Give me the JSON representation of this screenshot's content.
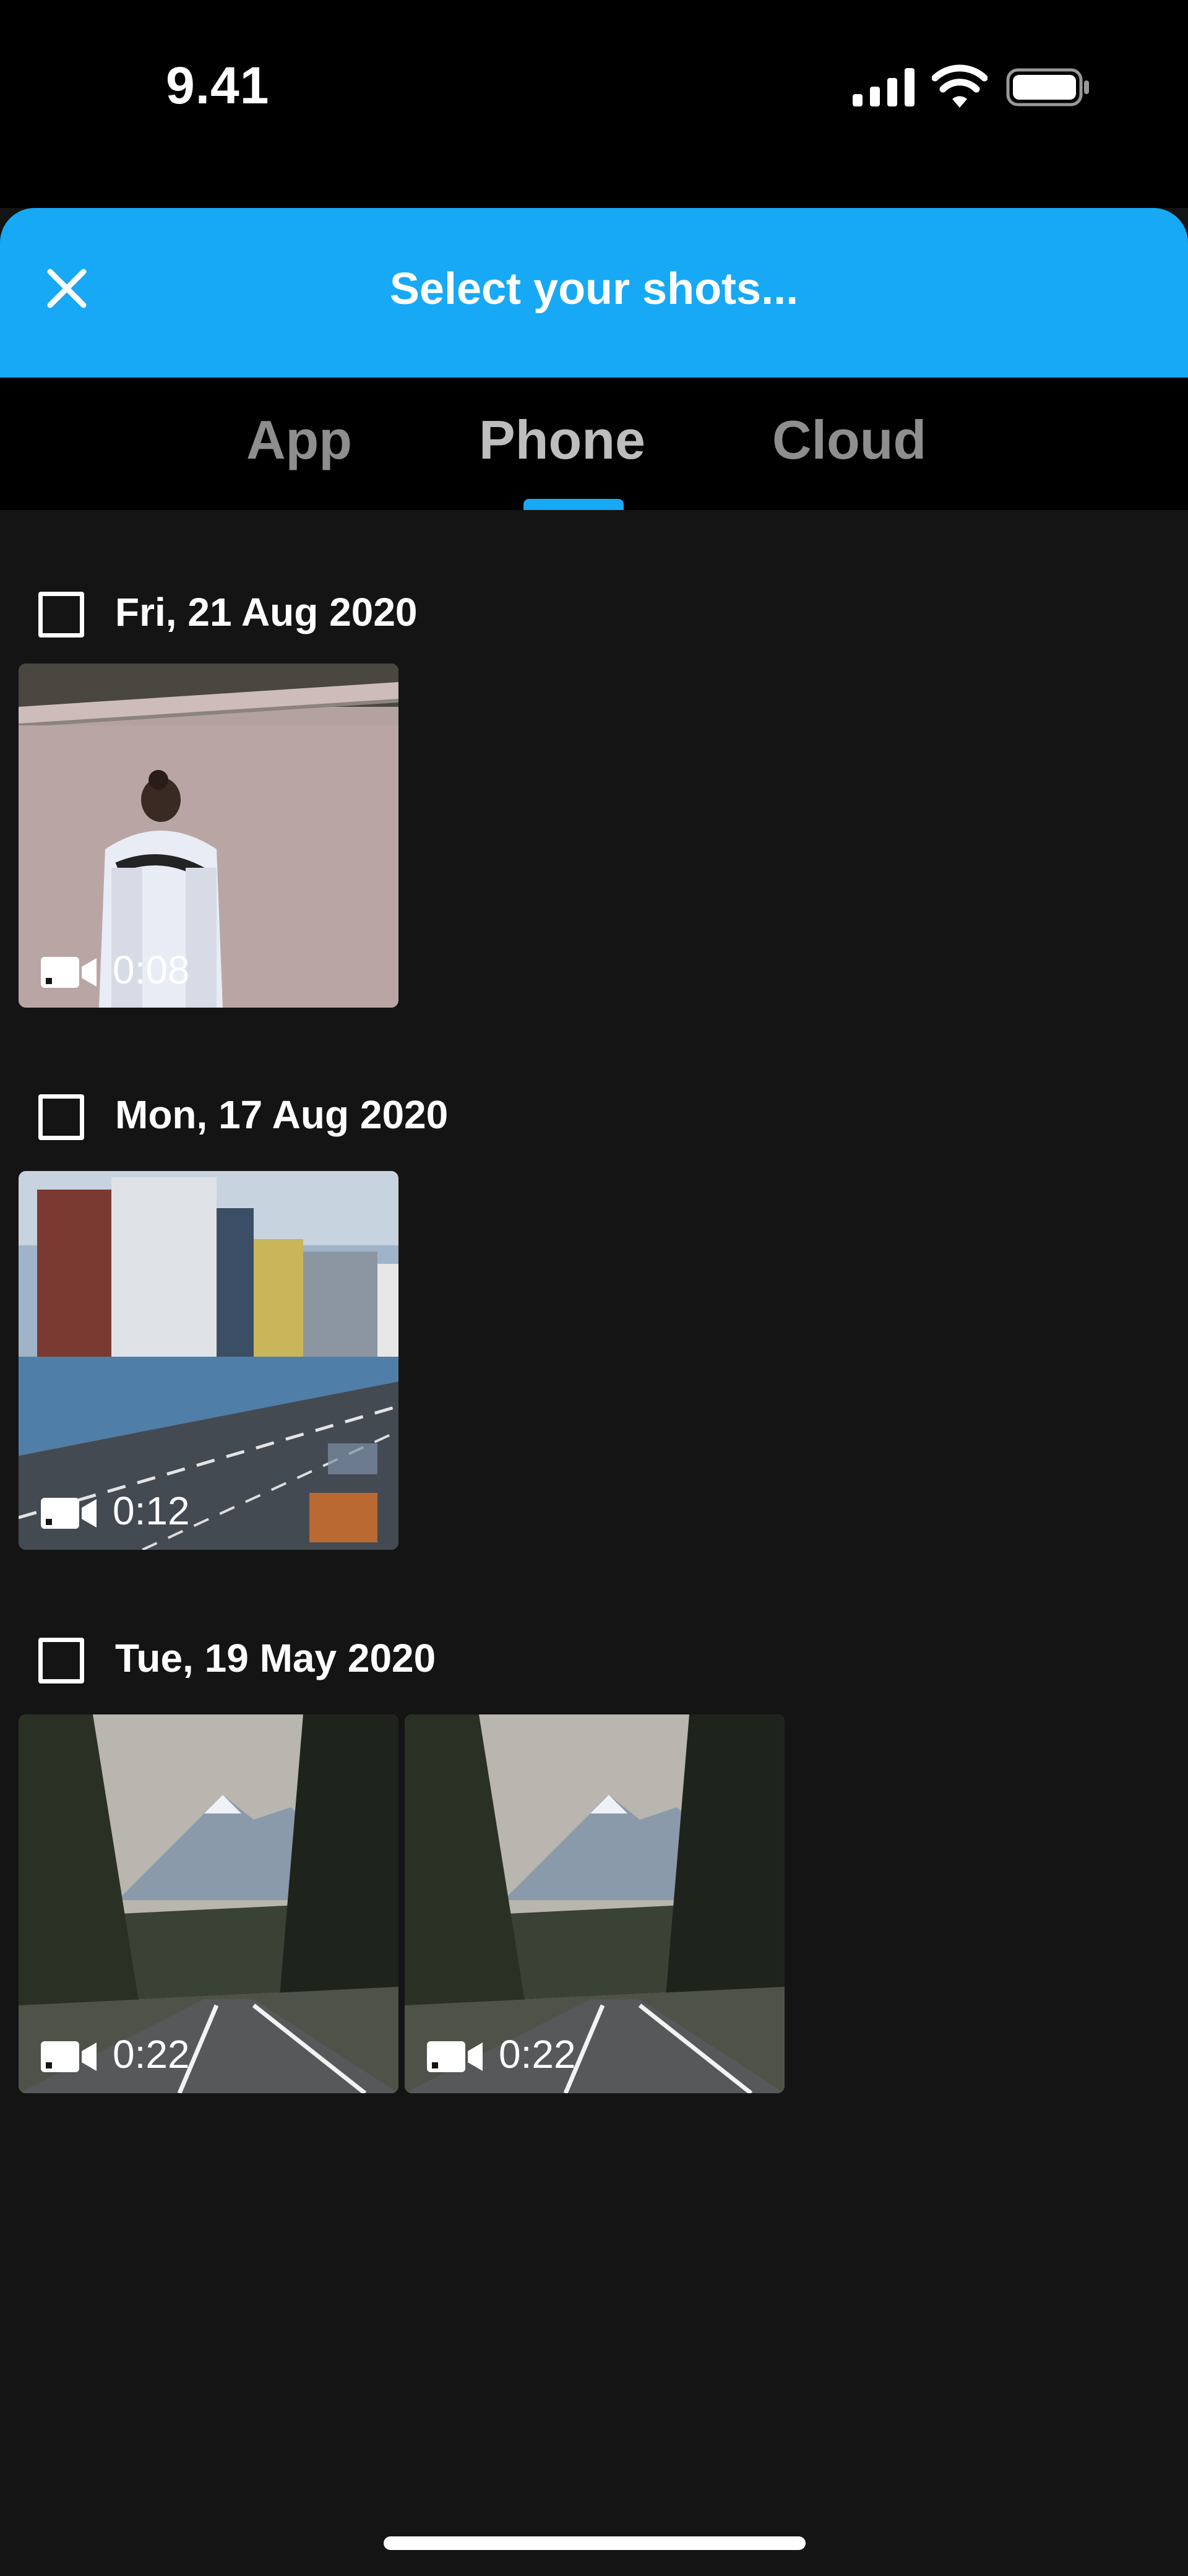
{
  "status_bar": {
    "time": "9.41"
  },
  "header": {
    "title": "Select your shots...",
    "close_icon": "close-icon"
  },
  "tabs": [
    {
      "label": "App",
      "active": false
    },
    {
      "label": "Phone",
      "active": true
    },
    {
      "label": "Cloud",
      "active": false
    }
  ],
  "groups": [
    {
      "date": "Fri, 21 Aug 2020",
      "items": [
        {
          "duration": "0:08",
          "scene": "skatepark-person"
        }
      ]
    },
    {
      "date": "Mon, 17 Aug 2020",
      "items": [
        {
          "duration": "0:12",
          "scene": "city-highway"
        }
      ]
    },
    {
      "date": "Tue, 19 May 2020",
      "items": [
        {
          "duration": "0:22",
          "scene": "mountain-road"
        },
        {
          "duration": "0:22",
          "scene": "mountain-road"
        }
      ]
    }
  ],
  "colors": {
    "accent": "#17a9f5",
    "background": "#141414"
  }
}
